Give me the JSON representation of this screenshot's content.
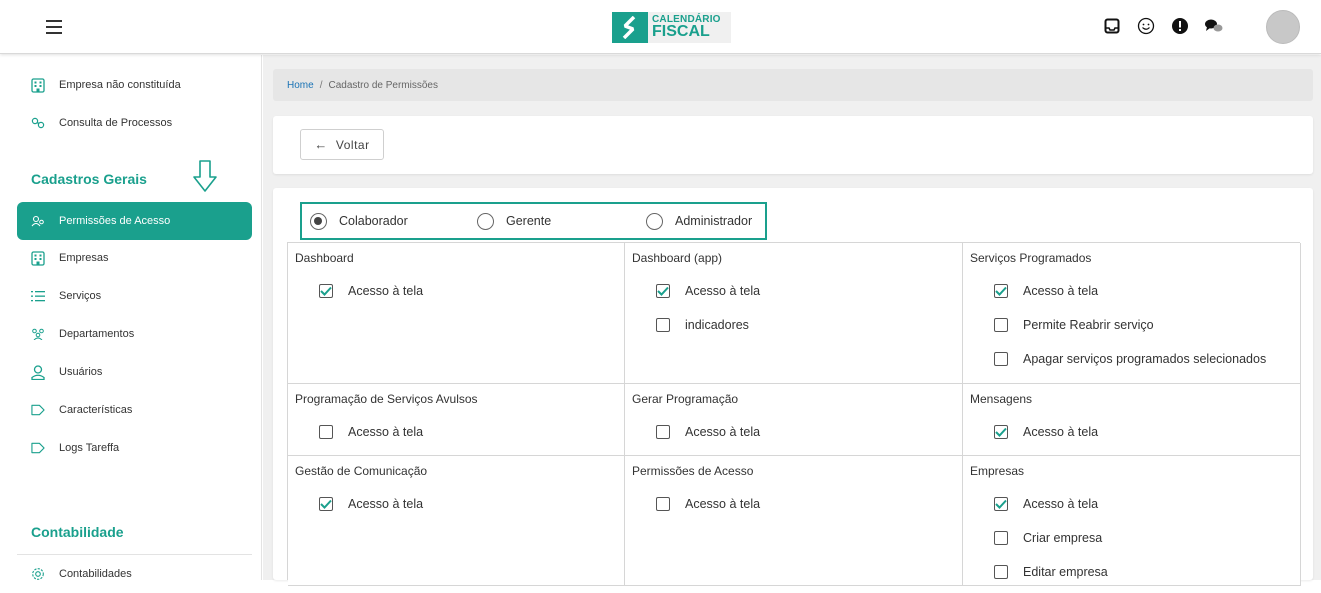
{
  "header": {
    "logo_line1": "CALENDÁRIO",
    "logo_line2": "FISCAL",
    "icons": [
      "inbox-icon",
      "smiley-icon",
      "alert-icon",
      "chat-icon",
      "avatar"
    ]
  },
  "sidebar": {
    "items_top": [
      {
        "label": "Empresa não constituída",
        "icon": "building-icon"
      },
      {
        "label": "Consulta de Processos",
        "icon": "link-icon"
      }
    ],
    "section1": "Cadastros Gerais",
    "items": [
      {
        "label": "Permissões de Acesso",
        "icon": "users-icon",
        "active": true
      },
      {
        "label": "Empresas",
        "icon": "building-icon"
      },
      {
        "label": "Serviços",
        "icon": "list-icon"
      },
      {
        "label": "Departamentos",
        "icon": "team-icon"
      },
      {
        "label": "Usuários",
        "icon": "user-icon"
      },
      {
        "label": "Características",
        "icon": "tag-icon"
      },
      {
        "label": "Logs Tareffa",
        "icon": "tag-icon"
      }
    ],
    "section2": "Contabilidade",
    "items_bottom": [
      {
        "label": "Contabilidades",
        "icon": "gear-icon"
      }
    ]
  },
  "breadcrumb": {
    "home": "Home",
    "separator": "/",
    "current": "Cadastro de Permissões"
  },
  "back_button": {
    "label": "Voltar"
  },
  "roles": [
    {
      "label": "Colaborador",
      "selected": true
    },
    {
      "label": "Gerente",
      "selected": false
    },
    {
      "label": "Administrador",
      "selected": false
    }
  ],
  "permissions": [
    {
      "title": "Dashboard",
      "options": [
        {
          "label": "Acesso à tela",
          "checked": true
        }
      ]
    },
    {
      "title": "Dashboard (app)",
      "options": [
        {
          "label": "Acesso à tela",
          "checked": true
        },
        {
          "label": "indicadores",
          "checked": false
        }
      ]
    },
    {
      "title": "Serviços Programados",
      "options": [
        {
          "label": "Acesso à tela",
          "checked": true
        },
        {
          "label": "Permite Reabrir serviço",
          "checked": false
        },
        {
          "label": "Apagar serviços programados selecionados",
          "checked": false
        }
      ]
    },
    {
      "title": "Programação de Serviços Avulsos",
      "options": [
        {
          "label": "Acesso à tela",
          "checked": false
        }
      ]
    },
    {
      "title": "Gerar Programação",
      "options": [
        {
          "label": "Acesso à tela",
          "checked": false
        }
      ]
    },
    {
      "title": "Mensagens",
      "options": [
        {
          "label": "Acesso à tela",
          "checked": true
        }
      ]
    },
    {
      "title": "Gestão de Comunicação",
      "options": [
        {
          "label": "Acesso à tela",
          "checked": true
        }
      ]
    },
    {
      "title": "Permissões de Acesso",
      "options": [
        {
          "label": "Acesso à tela",
          "checked": false
        }
      ]
    },
    {
      "title": "Empresas",
      "options": [
        {
          "label": "Acesso à tela",
          "checked": true
        },
        {
          "label": "Criar empresa",
          "checked": false
        },
        {
          "label": "Editar empresa",
          "checked": false
        }
      ]
    }
  ],
  "colors": {
    "accent": "#1aa08d",
    "link": "#1a73b5"
  }
}
